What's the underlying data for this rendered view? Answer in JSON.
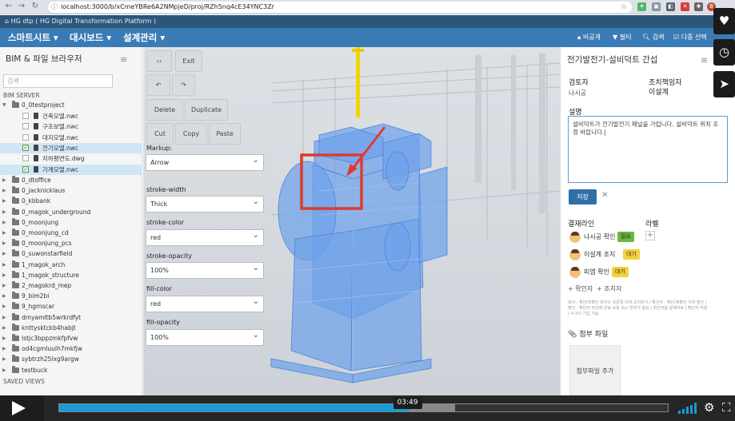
{
  "browser": {
    "back_icon": "back-arrow-icon",
    "forward_icon": "forward-arrow-icon",
    "reload_icon": "reload-icon",
    "url": "localhost:3000/b/xCmeYBRe6A2NMpjeD/proj/RZh5nq4cE34YNC3Zr",
    "profile_initial": "B"
  },
  "platform_title": "HG dtp ( HG Digital Transformation Platform )",
  "menubar": {
    "menus": [
      "스마트시트",
      "대시보드",
      "설계관리"
    ],
    "tools": [
      "비공개",
      "필터",
      "검색",
      "다중 선택"
    ]
  },
  "left_panel": {
    "title": "BIM & 파일 브라우저",
    "search_placeholder": "검색",
    "server_label": "BIM SERVER",
    "saved_views_label": "SAVED VIEWS",
    "project": "0_0testproject",
    "files": [
      {
        "name": "건축모델.nwc",
        "checked": false
      },
      {
        "name": "구조보델.nwc",
        "checked": false
      },
      {
        "name": "대지모델.nwc",
        "checked": false
      },
      {
        "name": "전기모델.nwc",
        "checked": true
      },
      {
        "name": "지하평면도.dwg",
        "checked": false
      },
      {
        "name": "기계모델.nwc",
        "checked": true
      }
    ],
    "folders": [
      "0_dtoffice",
      "0_jacknicklaus",
      "0_kbbank",
      "0_magok_underground",
      "0_moonjung",
      "0_moonjung_cd",
      "0_moonjung_pcs",
      "0_suwonstarfield",
      "1_magok_arch",
      "1_magok_structure",
      "2_magokrd_mep",
      "9_bim2bi",
      "9_hgmscar",
      "dmyamltb5wrkrdfyt",
      "knttysktckb4habjt",
      "lstjc3bppzmkfpfvw",
      "od4cgmluuih7mkfjw",
      "sybtrzh25lxg9argw",
      "testbuck"
    ]
  },
  "markup": {
    "code_icon": "code-brackets-icon",
    "exit": "Exit",
    "undo_icon": "undo-icon",
    "redo_icon": "redo-icon",
    "delete": "Delete",
    "duplicate": "Duplicate",
    "cut": "Cut",
    "copy": "Copy",
    "paste": "Paste",
    "markup_label": "Markup:",
    "markup_value": "Arrow",
    "stroke_width_label": "stroke-width",
    "stroke_width_value": "Thick",
    "stroke_color_label": "stroke-color",
    "stroke_color_value": "red",
    "stroke_opacity_label": "stroke-opacity",
    "stroke_opacity_value": "100%",
    "fill_color_label": "fill-color",
    "fill_color_value": "red",
    "fill_opacity_label": "fill-opacity",
    "fill_opacity_value": "100%"
  },
  "issue_panel": {
    "title": "전기발전기-설비덕트 간섭",
    "reviewer_label": "검토자",
    "reviewer": "나시공",
    "responsible_label": "조치책임자",
    "responsible": "이설계",
    "description_label": "설명",
    "description": "설비덕트가 전기발전기 패널을 가립니다. 설비덕트 위치 조정 바랍니다.|",
    "save_button": "저장",
    "approval_label": "결재라인",
    "label_label": "라벨",
    "approvals": [
      {
        "name": "나시공 확인",
        "status": "필요",
        "color": "#6cb83d"
      },
      {
        "name": "이설계 조치",
        "status": "대기",
        "color": "#f3d23b"
      },
      {
        "name": "피엠 확인",
        "status": "대기",
        "color": "#f3d23b"
      }
    ],
    "add_confirmer": "+ 확인자",
    "add_actor": "+ 조치자",
    "note": "회의 : 확인/미확인 마우스 오른쪽 이하 조치하기 / 확인자 : 확인/재확인 이하 확인 / 확인 · 확인자 하단에 완료 요청 또는 반려가 필요 | 확인자를 설계자로 | 확인자 허용 | 누구나 기입 가능",
    "attach_title": "첨부 파일",
    "attach_button": "첨부파일 추가"
  },
  "video": {
    "time": "03:49",
    "progress": 0.575,
    "buffered": 0.65
  },
  "colors": {
    "menubar": "#3b7bb5",
    "platform_bar": "#2c567a",
    "markup_red": "#e03a30",
    "model_blue": "#6fa2ea",
    "player_progress": "#1a9ad6"
  }
}
